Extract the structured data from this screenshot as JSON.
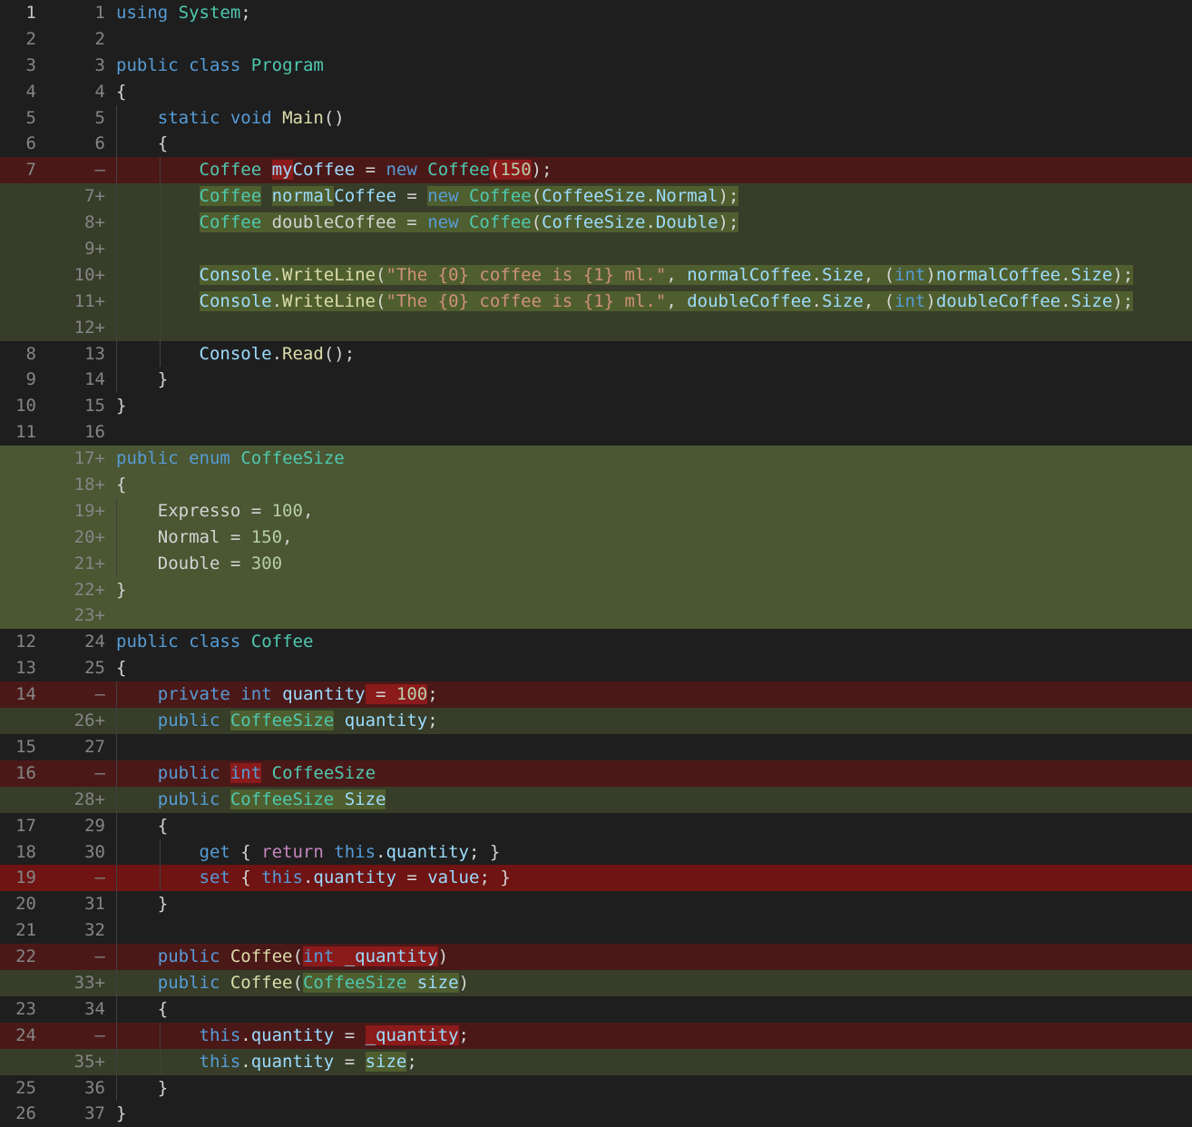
{
  "diff": {
    "rows": [
      {
        "type": "ctx",
        "old": "1",
        "new": "1",
        "indent": 0,
        "tokens": [
          [
            "kw",
            "using"
          ],
          [
            "pl",
            " "
          ],
          [
            "ty",
            "System"
          ],
          [
            "pl",
            ";"
          ]
        ]
      },
      {
        "type": "ctx",
        "old": "2",
        "new": "2",
        "indent": 0,
        "tokens": []
      },
      {
        "type": "ctx",
        "old": "3",
        "new": "3",
        "indent": 0,
        "tokens": [
          [
            "kw",
            "public"
          ],
          [
            "pl",
            " "
          ],
          [
            "kw",
            "class"
          ],
          [
            "pl",
            " "
          ],
          [
            "ty",
            "Program"
          ]
        ]
      },
      {
        "type": "ctx",
        "old": "4",
        "new": "4",
        "indent": 0,
        "tokens": [
          [
            "pl",
            "{"
          ]
        ]
      },
      {
        "type": "ctx",
        "old": "5",
        "new": "5",
        "indent": 1,
        "tokens": [
          [
            "kw",
            "static"
          ],
          [
            "pl",
            " "
          ],
          [
            "kw",
            "void"
          ],
          [
            "pl",
            " "
          ],
          [
            "fn",
            "Main"
          ],
          [
            "pl",
            "()"
          ]
        ]
      },
      {
        "type": "ctx",
        "old": "6",
        "new": "6",
        "indent": 1,
        "tokens": [
          [
            "pl",
            "{"
          ]
        ]
      },
      {
        "type": "del",
        "old": "7",
        "new": "—",
        "indent": 2,
        "tokens": [
          [
            "ty",
            "Coffee"
          ],
          [
            "pl",
            " "
          ],
          [
            "var",
            "my",
            "del"
          ],
          [
            "var",
            "Coffee"
          ],
          [
            "pl",
            " = "
          ],
          [
            "kw",
            "new"
          ],
          [
            "pl",
            " "
          ],
          [
            "ty",
            "Coffee"
          ],
          [
            "pl",
            "(",
            "del"
          ],
          [
            "num",
            "150",
            "del"
          ],
          [
            "pl",
            ");"
          ]
        ]
      },
      {
        "type": "add",
        "old": "",
        "new": "7+",
        "indent": 2,
        "tokens": [
          [
            "ty",
            "Coffee",
            "add"
          ],
          [
            "pl",
            " "
          ],
          [
            "var",
            "normal",
            "add"
          ],
          [
            "var",
            "Coffee"
          ],
          [
            "pl",
            " = "
          ],
          [
            "kw",
            "new",
            "add"
          ],
          [
            "pl",
            " ",
            "add"
          ],
          [
            "ty",
            "Coffee",
            "add"
          ],
          [
            "pl",
            "(",
            "add"
          ],
          [
            "var",
            "CoffeeSize",
            "add"
          ],
          [
            "pl",
            ".",
            "add"
          ],
          [
            "var",
            "Normal",
            "add"
          ],
          [
            "pl",
            ");",
            "add"
          ]
        ]
      },
      {
        "type": "add",
        "old": "",
        "new": "8+",
        "indent": 2,
        "tokens": [
          [
            "ty",
            "Coffee",
            "add"
          ],
          [
            "pl",
            " doubleCoffee = ",
            "add"
          ],
          [
            "kw",
            "new",
            "add"
          ],
          [
            "pl",
            " ",
            "add"
          ],
          [
            "ty",
            "Coffee",
            "add"
          ],
          [
            "pl",
            "(",
            "add"
          ],
          [
            "var",
            "CoffeeSize",
            "add"
          ],
          [
            "pl",
            ".",
            "add"
          ],
          [
            "var",
            "Double",
            "add"
          ],
          [
            "pl",
            ");",
            "add"
          ]
        ]
      },
      {
        "type": "add",
        "old": "",
        "new": "9+",
        "indent": 2,
        "tokens": []
      },
      {
        "type": "add",
        "old": "",
        "new": "10+",
        "indent": 2,
        "tokens": [
          [
            "var",
            "Console",
            "add"
          ],
          [
            "pl",
            ".",
            "add"
          ],
          [
            "fn",
            "WriteLine",
            "add"
          ],
          [
            "pl",
            "(",
            "add"
          ],
          [
            "str",
            "\"The {0} coffee is {1} ml.\"",
            "add"
          ],
          [
            "pl",
            ", ",
            "add"
          ],
          [
            "var",
            "normalCoffee",
            "add"
          ],
          [
            "pl",
            ".",
            "add"
          ],
          [
            "var",
            "Size",
            "add"
          ],
          [
            "pl",
            ", (",
            "add"
          ],
          [
            "kw",
            "int",
            "add"
          ],
          [
            "pl",
            ")",
            "add"
          ],
          [
            "var",
            "normalCoffee",
            "add"
          ],
          [
            "pl",
            ".",
            "add"
          ],
          [
            "var",
            "Size",
            "add"
          ],
          [
            "pl",
            ");",
            "add"
          ]
        ]
      },
      {
        "type": "add",
        "old": "",
        "new": "11+",
        "indent": 2,
        "tokens": [
          [
            "var",
            "Console",
            "add"
          ],
          [
            "pl",
            ".",
            "add"
          ],
          [
            "fn",
            "WriteLine",
            "add"
          ],
          [
            "pl",
            "(",
            "add"
          ],
          [
            "str",
            "\"The {0} coffee is {1} ml.\"",
            "add"
          ],
          [
            "pl",
            ", ",
            "add"
          ],
          [
            "var",
            "doubleCoffee",
            "add"
          ],
          [
            "pl",
            ".",
            "add"
          ],
          [
            "var",
            "Size",
            "add"
          ],
          [
            "pl",
            ", (",
            "add"
          ],
          [
            "kw",
            "int",
            "add"
          ],
          [
            "pl",
            ")",
            "add"
          ],
          [
            "var",
            "doubleCoffee",
            "add"
          ],
          [
            "pl",
            ".",
            "add"
          ],
          [
            "var",
            "Size",
            "add"
          ],
          [
            "pl",
            ");",
            "add"
          ]
        ]
      },
      {
        "type": "add",
        "old": "",
        "new": "12+",
        "indent": 2,
        "tokens": []
      },
      {
        "type": "ctx",
        "old": "8",
        "new": "13",
        "indent": 2,
        "tokens": [
          [
            "var",
            "Console"
          ],
          [
            "pl",
            "."
          ],
          [
            "fn",
            "Read"
          ],
          [
            "pl",
            "();"
          ]
        ]
      },
      {
        "type": "ctx",
        "old": "9",
        "new": "14",
        "indent": 1,
        "tokens": [
          [
            "pl",
            "}"
          ]
        ]
      },
      {
        "type": "ctx",
        "old": "10",
        "new": "15",
        "indent": 0,
        "tokens": [
          [
            "pl",
            "}"
          ]
        ]
      },
      {
        "type": "ctx",
        "old": "11",
        "new": "16",
        "indent": 0,
        "tokens": []
      },
      {
        "type": "addblock",
        "old": "",
        "new": "17+",
        "indent": 0,
        "tokens": [
          [
            "kw",
            "public"
          ],
          [
            "pl",
            " "
          ],
          [
            "kw",
            "enum"
          ],
          [
            "pl",
            " "
          ],
          [
            "ty",
            "CoffeeSize"
          ]
        ]
      },
      {
        "type": "addblock",
        "old": "",
        "new": "18+",
        "indent": 0,
        "tokens": [
          [
            "pl",
            "{"
          ]
        ]
      },
      {
        "type": "addblock",
        "old": "",
        "new": "19+",
        "indent": 1,
        "tokens": [
          [
            "pl",
            "Expresso = "
          ],
          [
            "num",
            "100"
          ],
          [
            "pl",
            ","
          ]
        ]
      },
      {
        "type": "addblock",
        "old": "",
        "new": "20+",
        "indent": 1,
        "tokens": [
          [
            "pl",
            "Normal = "
          ],
          [
            "num",
            "150"
          ],
          [
            "pl",
            ","
          ]
        ]
      },
      {
        "type": "addblock",
        "old": "",
        "new": "21+",
        "indent": 1,
        "tokens": [
          [
            "pl",
            "Double = "
          ],
          [
            "num",
            "300"
          ]
        ]
      },
      {
        "type": "addblock",
        "old": "",
        "new": "22+",
        "indent": 0,
        "tokens": [
          [
            "pl",
            "}"
          ]
        ]
      },
      {
        "type": "addblock",
        "old": "",
        "new": "23+",
        "indent": 0,
        "tokens": []
      },
      {
        "type": "ctx",
        "old": "12",
        "new": "24",
        "indent": 0,
        "tokens": [
          [
            "kw",
            "public"
          ],
          [
            "pl",
            " "
          ],
          [
            "kw",
            "class"
          ],
          [
            "pl",
            " "
          ],
          [
            "ty",
            "Coffee"
          ]
        ]
      },
      {
        "type": "ctx",
        "old": "13",
        "new": "25",
        "indent": 0,
        "tokens": [
          [
            "pl",
            "{"
          ]
        ]
      },
      {
        "type": "del",
        "old": "14",
        "new": "—",
        "indent": 1,
        "tokens": [
          [
            "kw",
            "private"
          ],
          [
            "pl",
            " "
          ],
          [
            "kw",
            "int"
          ],
          [
            "pl",
            " "
          ],
          [
            "var",
            "quantity"
          ],
          [
            "pl",
            " = ",
            "del"
          ],
          [
            "num",
            "100",
            "del"
          ],
          [
            "pl",
            ";"
          ]
        ]
      },
      {
        "type": "add",
        "old": "",
        "new": "26+",
        "indent": 1,
        "tokens": [
          [
            "kw",
            "public"
          ],
          [
            "pl",
            " "
          ],
          [
            "ty",
            "CoffeeSize",
            "add"
          ],
          [
            "pl",
            " "
          ],
          [
            "var",
            "quantity"
          ],
          [
            "pl",
            ";"
          ]
        ]
      },
      {
        "type": "ctx",
        "old": "15",
        "new": "27",
        "indent": 1,
        "tokens": []
      },
      {
        "type": "del",
        "old": "16",
        "new": "—",
        "indent": 1,
        "tokens": [
          [
            "kw",
            "public"
          ],
          [
            "pl",
            " "
          ],
          [
            "kw",
            "int",
            "del"
          ],
          [
            "pl",
            " "
          ],
          [
            "ty",
            "CoffeeSize"
          ]
        ]
      },
      {
        "type": "add",
        "old": "",
        "new": "28+",
        "indent": 1,
        "tokens": [
          [
            "kw",
            "public"
          ],
          [
            "pl",
            " "
          ],
          [
            "ty",
            "CoffeeSize",
            "add"
          ],
          [
            "pl",
            " ",
            "add"
          ],
          [
            "var",
            "Size",
            "add"
          ]
        ]
      },
      {
        "type": "ctx",
        "old": "17",
        "new": "29",
        "indent": 1,
        "tokens": [
          [
            "pl",
            "{"
          ]
        ]
      },
      {
        "type": "ctx",
        "old": "18",
        "new": "30",
        "indent": 2,
        "tokens": [
          [
            "kw",
            "get"
          ],
          [
            "pl",
            " { "
          ],
          [
            "ctl",
            "return"
          ],
          [
            "pl",
            " "
          ],
          [
            "kw",
            "this"
          ],
          [
            "pl",
            "."
          ],
          [
            "var",
            "quantity"
          ],
          [
            "pl",
            "; }"
          ]
        ]
      },
      {
        "type": "delstrong",
        "old": "19",
        "new": "—",
        "indent": 2,
        "tokens": [
          [
            "kw",
            "set"
          ],
          [
            "pl",
            " { "
          ],
          [
            "kw",
            "this"
          ],
          [
            "pl",
            "."
          ],
          [
            "var",
            "quantity"
          ],
          [
            "pl",
            " = "
          ],
          [
            "var",
            "value"
          ],
          [
            "pl",
            "; }"
          ]
        ]
      },
      {
        "type": "ctx",
        "old": "20",
        "new": "31",
        "indent": 1,
        "tokens": [
          [
            "pl",
            "}"
          ]
        ]
      },
      {
        "type": "ctx",
        "old": "21",
        "new": "32",
        "indent": 1,
        "tokens": []
      },
      {
        "type": "del",
        "old": "22",
        "new": "—",
        "indent": 1,
        "tokens": [
          [
            "kw",
            "public"
          ],
          [
            "pl",
            " "
          ],
          [
            "fn",
            "Coffee"
          ],
          [
            "pl",
            "("
          ],
          [
            "kw",
            "int",
            "del"
          ],
          [
            "pl",
            " ",
            "del"
          ],
          [
            "var",
            "_quantity",
            "del"
          ],
          [
            "pl",
            ")"
          ]
        ]
      },
      {
        "type": "add",
        "old": "",
        "new": "33+",
        "indent": 1,
        "tokens": [
          [
            "kw",
            "public"
          ],
          [
            "pl",
            " "
          ],
          [
            "fn",
            "Coffee"
          ],
          [
            "pl",
            "("
          ],
          [
            "ty",
            "CoffeeSize",
            "add"
          ],
          [
            "pl",
            " ",
            "add"
          ],
          [
            "var",
            "size",
            "add"
          ],
          [
            "pl",
            ")"
          ]
        ]
      },
      {
        "type": "ctx",
        "old": "23",
        "new": "34",
        "indent": 1,
        "tokens": [
          [
            "pl",
            "{"
          ]
        ]
      },
      {
        "type": "del",
        "old": "24",
        "new": "—",
        "indent": 2,
        "tokens": [
          [
            "kw",
            "this"
          ],
          [
            "pl",
            "."
          ],
          [
            "var",
            "quantity"
          ],
          [
            "pl",
            " = "
          ],
          [
            "var",
            "_quantity",
            "del"
          ],
          [
            "pl",
            ";"
          ]
        ]
      },
      {
        "type": "add",
        "old": "",
        "new": "35+",
        "indent": 2,
        "tokens": [
          [
            "kw",
            "this"
          ],
          [
            "pl",
            "."
          ],
          [
            "var",
            "quantity"
          ],
          [
            "pl",
            " = "
          ],
          [
            "var",
            "size",
            "add"
          ],
          [
            "pl",
            ";"
          ]
        ]
      },
      {
        "type": "ctx",
        "old": "25",
        "new": "36",
        "indent": 1,
        "tokens": [
          [
            "pl",
            "}"
          ]
        ]
      },
      {
        "type": "ctx",
        "old": "26",
        "new": "37",
        "indent": 0,
        "tokens": [
          [
            "pl",
            "}"
          ]
        ]
      }
    ]
  }
}
